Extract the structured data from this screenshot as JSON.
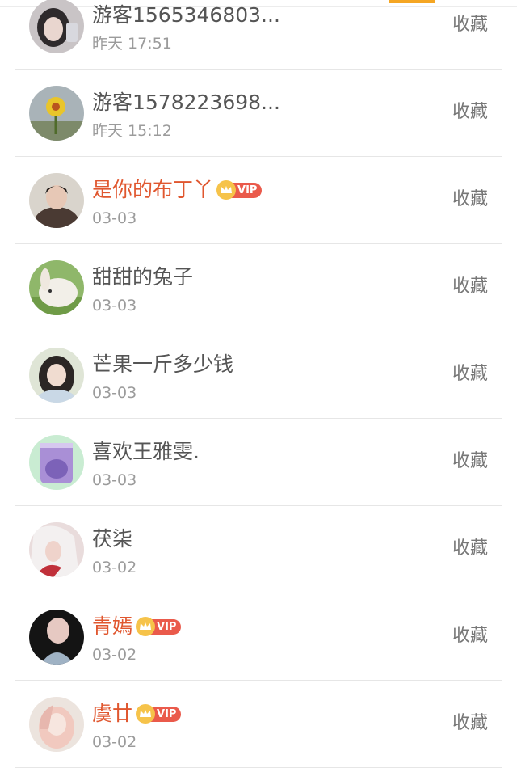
{
  "items": [
    {
      "name": "游客1565346803...",
      "date": "昨天 17:51",
      "action": "收藏",
      "vip": false,
      "badge": ""
    },
    {
      "name": "游客1578223698...",
      "date": "昨天 15:12",
      "action": "收藏",
      "vip": false,
      "badge": ""
    },
    {
      "name": "是你的布丁丫",
      "date": "03-03",
      "action": "收藏",
      "vip": true,
      "badge": "VIP"
    },
    {
      "name": "甜甜的兔子",
      "date": "03-03",
      "action": "收藏",
      "vip": false,
      "badge": ""
    },
    {
      "name": "芒果一斤多少钱",
      "date": "03-03",
      "action": "收藏",
      "vip": false,
      "badge": ""
    },
    {
      "name": "喜欢王雅雯.",
      "date": "03-03",
      "action": "收藏",
      "vip": false,
      "badge": ""
    },
    {
      "name": "茯柒",
      "date": "03-02",
      "action": "收藏",
      "vip": false,
      "badge": ""
    },
    {
      "name": "青嫣",
      "date": "03-02",
      "action": "收藏",
      "vip": true,
      "badge": "VIP"
    },
    {
      "name": "虞廿",
      "date": "03-02",
      "action": "收藏",
      "vip": true,
      "badge": "VIP"
    }
  ],
  "colors": {
    "accent": "#f5a623",
    "vip_name": "#e0572f",
    "vip_badge": "#ea5a4b",
    "crown": "#f6c34a"
  }
}
